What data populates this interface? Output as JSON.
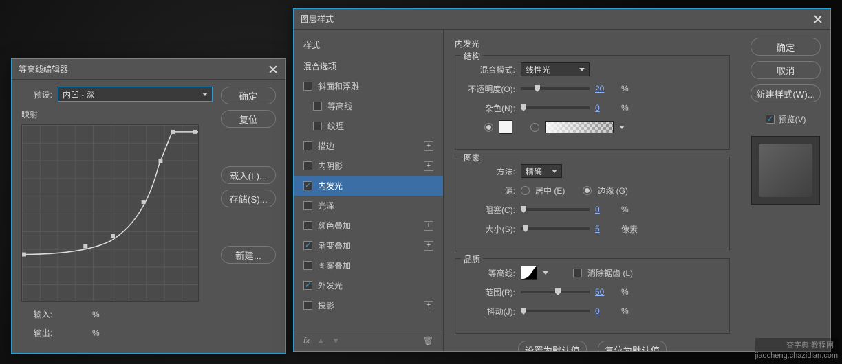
{
  "contourDialog": {
    "title": "等高线编辑器",
    "presetLabel": "预设:",
    "presetValue": "内凹 - 深",
    "mappingLabel": "映射",
    "inputLabel": "输入:",
    "outputLabel": "输出:",
    "percent": "%",
    "buttons": {
      "ok": "确定",
      "reset": "复位",
      "load": "载入(L)...",
      "save": "存储(S)...",
      "new": "新建..."
    }
  },
  "layerStyle": {
    "title": "图层样式",
    "stylesHeader": "样式",
    "blendOptions": "混合选项",
    "styles": {
      "bevelEmboss": "斜面和浮雕",
      "contour": "等高线",
      "texture": "纹理",
      "stroke": "描边",
      "innerShadow": "内阴影",
      "innerGlow": "内发光",
      "satin": "光泽",
      "colorOverlay": "颜色叠加",
      "gradientOverlay": "渐变叠加",
      "patternOverlay": "图案叠加",
      "outerGlow": "外发光",
      "dropShadow": "投影"
    },
    "fx": "fx",
    "panel": {
      "title": "内发光",
      "structure": {
        "legend": "结构",
        "blendModeLabel": "混合模式:",
        "blendModeValue": "线性光",
        "opacityLabel": "不透明度(O):",
        "opacityValue": "20",
        "noiseLabel": "杂色(N):",
        "noiseValue": "0",
        "percent": "%"
      },
      "elements": {
        "legend": "图素",
        "techniqueLabel": "方法:",
        "techniqueValue": "精确",
        "sourceLabel": "源:",
        "sourceCenter": "居中 (E)",
        "sourceEdge": "边缘 (G)",
        "chokeLabel": "阻塞(C):",
        "chokeValue": "0",
        "sizeLabel": "大小(S):",
        "sizeValue": "5",
        "sizeUnit": "像素",
        "percent": "%"
      },
      "quality": {
        "legend": "品质",
        "contourLabel": "等高线:",
        "antiAlias": "消除锯齿 (L)",
        "rangeLabel": "范围(R):",
        "rangeValue": "50",
        "jitterLabel": "抖动(J):",
        "jitterValue": "0",
        "percent": "%"
      },
      "makeDefault": "设置为默认值",
      "resetDefault": "复位为默认值"
    },
    "actions": {
      "ok": "确定",
      "cancel": "取消",
      "newStyle": "新建样式(W)...",
      "preview": "预览(V)"
    }
  },
  "watermark": {
    "line1": "查字典 教程网",
    "line2": "jiaocheng.chazidian.com"
  }
}
